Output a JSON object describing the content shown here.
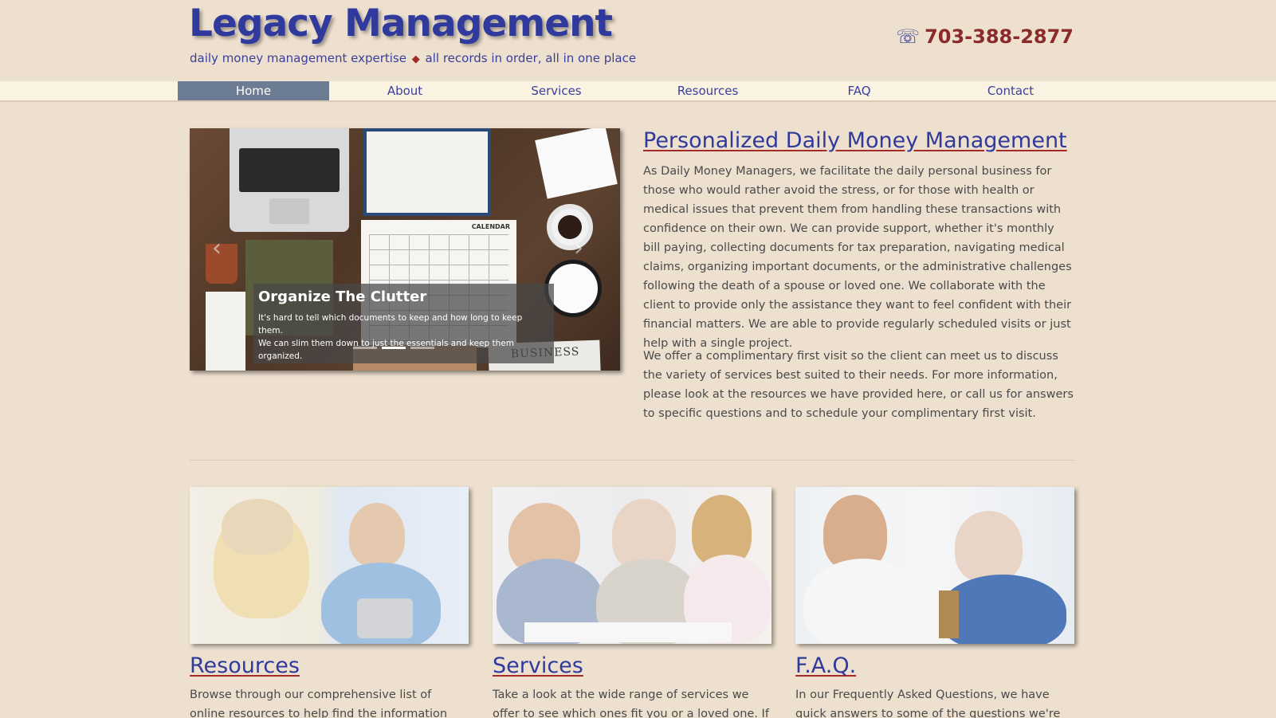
{
  "header": {
    "title": "Legacy Management",
    "tagline_left": "daily money management expertise",
    "tagline_separator": "◆",
    "tagline_right": "all records in order, all in one place",
    "phone": "703-388-2877",
    "phone_icon": "telephone-icon"
  },
  "nav": {
    "items": [
      {
        "label": "Home",
        "active": true
      },
      {
        "label": "About"
      },
      {
        "label": "Services"
      },
      {
        "label": "Resources"
      },
      {
        "label": "FAQ"
      },
      {
        "label": "Contact"
      }
    ]
  },
  "carousel": {
    "caption_title": "Organize The Clutter",
    "caption_line1": "It's hard to tell which documents to keep and how long to keep them.",
    "caption_line2": "We can slim them down to just the essentials and keep them organized.",
    "calendar_label": "CALENDAR",
    "paper_label": "BUSINESS",
    "prev_glyph": "‹",
    "next_glyph": "›",
    "slides": 3,
    "active_slide": 2
  },
  "intro": {
    "heading": "Personalized Daily Money Management",
    "p1": "As Daily Money Managers, we facilitate the daily personal business for those who would rather avoid the stress, or for those with health or medical issues that prevent them from handling these transactions with confidence on their own. We can provide support, whether it's monthly bill paying, collecting documents for tax preparation, navigating medical claims, organizing important documents, or the administrative challenges following the death of a spouse or loved one. We collaborate with the client to provide only the assistance they want to feel confident with their financial matters. We are able to provide regularly scheduled visits or just help with a single project.",
    "p2": "We offer a complimentary first visit so the client can meet us to discuss the variety of services best suited to their needs. For more information, please look at the resources we have provided here, or call us for answers to specific questions and to schedule your complimentary first visit."
  },
  "features": [
    {
      "heading": "Resources",
      "text": "Browse through our comprehensive list of online resources to help find the information you need"
    },
    {
      "heading": "Services",
      "text": "Take a look at the wide range of services we offer to see which ones fit you or a loved one. If the"
    },
    {
      "heading": "F.A.Q.",
      "text": "In our Frequently Asked Questions, we have quick answers to some of the questions we're"
    }
  ],
  "colors": {
    "background": "#eee0cf",
    "brand_blue": "#2f3a9c",
    "accent_red": "#8b2a2a",
    "nav_active": "#6c7c92"
  }
}
